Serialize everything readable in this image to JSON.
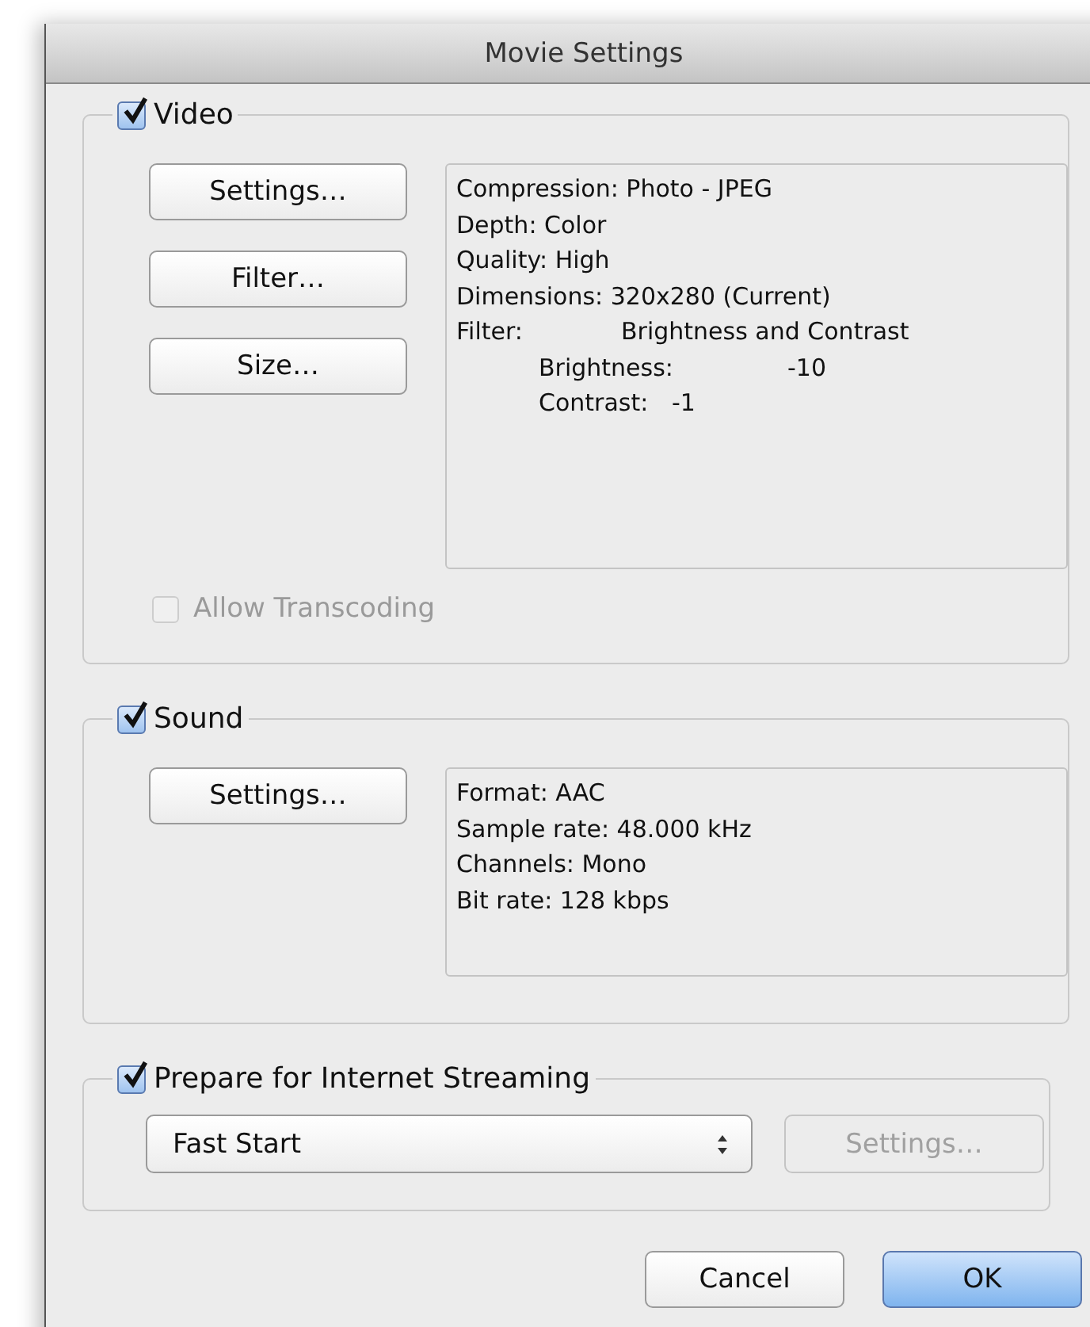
{
  "window": {
    "title": "Movie Settings"
  },
  "video": {
    "label": "Video",
    "checked": true,
    "buttons": [
      {
        "label": "Settings…",
        "disabled": false
      },
      {
        "label": "Filter…",
        "disabled": false
      },
      {
        "label": "Size…",
        "disabled": false
      }
    ],
    "info": [
      "Compression: Photo - JPEG",
      "Depth: Color",
      "Quality: High",
      "Dimensions: 320x280 (Current)"
    ],
    "filter": {
      "label": "Filter:",
      "value": "Brightness and Contrast",
      "children": [
        {
          "label": "Brightness:",
          "value": "-10"
        },
        {
          "label": "Contrast:",
          "value": "-1"
        }
      ]
    },
    "transcoding": {
      "label": "Allow Transcoding",
      "checked": false,
      "disabled": true
    }
  },
  "sound": {
    "label": "Sound",
    "checked": true,
    "buttons": [
      {
        "label": "Settings…",
        "disabled": false
      }
    ],
    "info": [
      "Format: AAC",
      "Sample rate: 48.000 kHz",
      "Channels: Mono",
      "Bit rate: 128 kbps"
    ]
  },
  "streaming": {
    "label": "Prepare for Internet Streaming",
    "checked": true,
    "select": {
      "value": "Fast Start"
    },
    "settings_button": {
      "label": "Settings…",
      "disabled": true
    }
  },
  "buttons": [
    {
      "label": "Cancel",
      "default": false
    },
    {
      "label": "OK",
      "default": true
    }
  ]
}
